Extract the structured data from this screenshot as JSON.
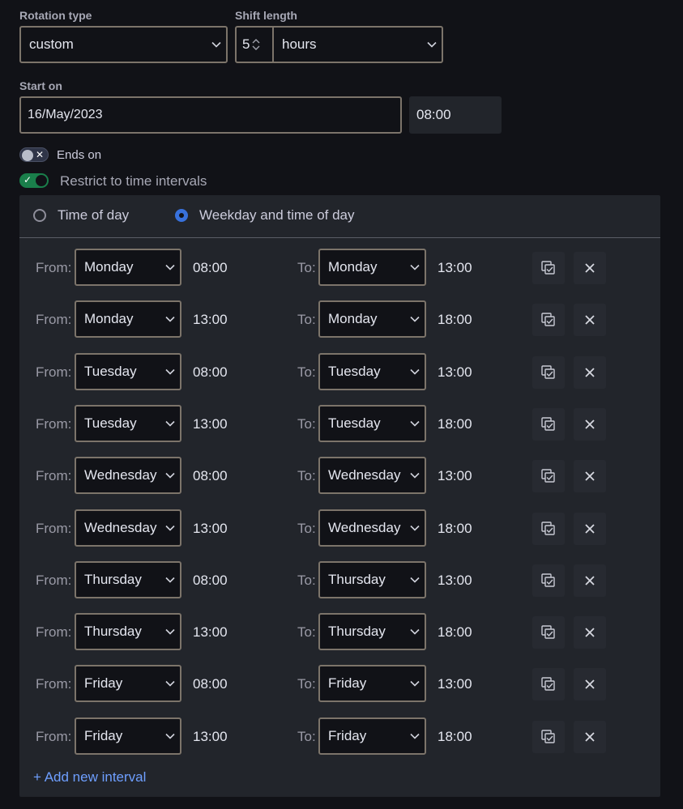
{
  "rotation": {
    "label": "Rotation type",
    "value": "custom"
  },
  "shift": {
    "label": "Shift length",
    "amount": "5",
    "unit": "hours"
  },
  "start": {
    "label": "Start on",
    "date": "16/May/2023",
    "time": "08:00"
  },
  "ends_on": {
    "label": "Ends on",
    "enabled": false
  },
  "restrict": {
    "label": "Restrict to time intervals",
    "enabled": true
  },
  "mode": {
    "options": [
      "Time of day",
      "Weekday and time of day"
    ],
    "selected": "Weekday and time of day"
  },
  "interval_labels": {
    "from": "From:",
    "to": "To:"
  },
  "intervals": [
    {
      "from_day": "Monday",
      "from_time": "08:00",
      "to_day": "Monday",
      "to_time": "13:00"
    },
    {
      "from_day": "Monday",
      "from_time": "13:00",
      "to_day": "Monday",
      "to_time": "18:00"
    },
    {
      "from_day": "Tuesday",
      "from_time": "08:00",
      "to_day": "Tuesday",
      "to_time": "13:00"
    },
    {
      "from_day": "Tuesday",
      "from_time": "13:00",
      "to_day": "Tuesday",
      "to_time": "18:00"
    },
    {
      "from_day": "Wednesday",
      "from_time": "08:00",
      "to_day": "Wednesday",
      "to_time": "13:00"
    },
    {
      "from_day": "Wednesday",
      "from_time": "13:00",
      "to_day": "Wednesday",
      "to_time": "18:00"
    },
    {
      "from_day": "Thursday",
      "from_time": "08:00",
      "to_day": "Thursday",
      "to_time": "13:00"
    },
    {
      "from_day": "Thursday",
      "from_time": "13:00",
      "to_day": "Thursday",
      "to_time": "18:00"
    },
    {
      "from_day": "Friday",
      "from_time": "08:00",
      "to_day": "Friday",
      "to_time": "13:00"
    },
    {
      "from_day": "Friday",
      "from_time": "13:00",
      "to_day": "Friday",
      "to_time": "18:00"
    }
  ],
  "add_interval_label": "+ Add new interval",
  "icons": {
    "duplicate": "copy-icon",
    "remove": "close-icon",
    "dropdown": "chevron-down-icon"
  },
  "colors": {
    "accent_blue": "#3871dc",
    "toggle_on": "#1a7f4b",
    "link": "#6e9fff"
  }
}
